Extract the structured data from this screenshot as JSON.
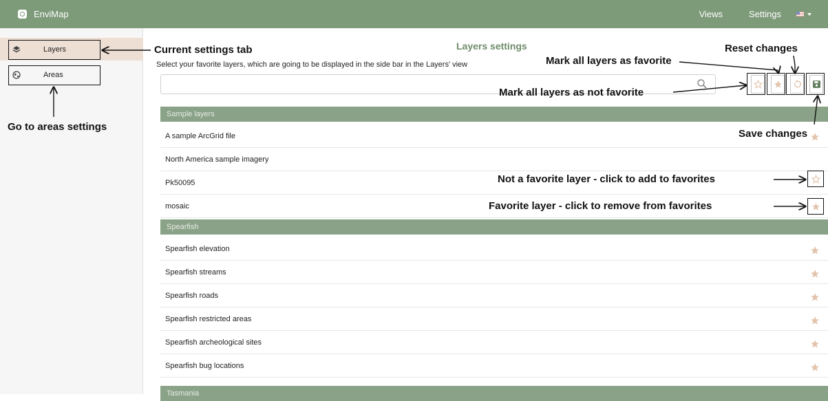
{
  "navbar": {
    "app_name": "EnviMap",
    "views_label": "Views",
    "settings_label": "Settings",
    "language_flag": "us-flag-icon"
  },
  "sidebar": {
    "items": [
      {
        "label": "Layers",
        "icon": "layers-icon",
        "active": true
      },
      {
        "label": "Areas",
        "icon": "globe-icon",
        "active": false
      }
    ]
  },
  "main": {
    "title": "Layers settings",
    "subtitle": "Select your favorite layers, which are going to be displayed in the side bar in the Layers' view",
    "search_value": "",
    "search_placeholder": "",
    "toolbar": [
      "star-outline-icon",
      "star-filled-icon",
      "reset-icon",
      "save-icon"
    ],
    "groups": [
      {
        "name": "Sample layers",
        "layers": [
          {
            "name": "A sample ArcGrid file",
            "favorite": true
          },
          {
            "name": "North America sample imagery",
            "favorite": false
          },
          {
            "name": "Pk50095",
            "favorite": true
          },
          {
            "name": "mosaic",
            "favorite": true
          }
        ]
      },
      {
        "name": "Spearfish",
        "layers": [
          {
            "name": "Spearfish elevation",
            "favorite": true
          },
          {
            "name": "Spearfish streams",
            "favorite": true
          },
          {
            "name": "Spearfish roads",
            "favorite": true
          },
          {
            "name": "Spearfish restricted areas",
            "favorite": true
          },
          {
            "name": "Spearfish archeological sites",
            "favorite": true
          },
          {
            "name": "Spearfish bug locations",
            "favorite": true
          }
        ]
      },
      {
        "name": "Tasmania",
        "layers": []
      }
    ]
  },
  "annotations": {
    "current_tab": "Current settings tab",
    "go_areas": "Go to areas settings",
    "mark_all_fav": "Mark all layers as favorite",
    "reset": "Reset changes",
    "mark_all_not_fav": "Mark all layers as not favorite",
    "save": "Save changes",
    "not_fav": "Not a favorite layer - click to add to favorites",
    "fav": "Favorite layer - click to remove from favorites"
  },
  "colors": {
    "navbar": "#7d9a79",
    "group_header": "#8aa287",
    "title": "#6e8c69",
    "star": "#e3c3ab",
    "active_tab": "#eedfd4"
  }
}
